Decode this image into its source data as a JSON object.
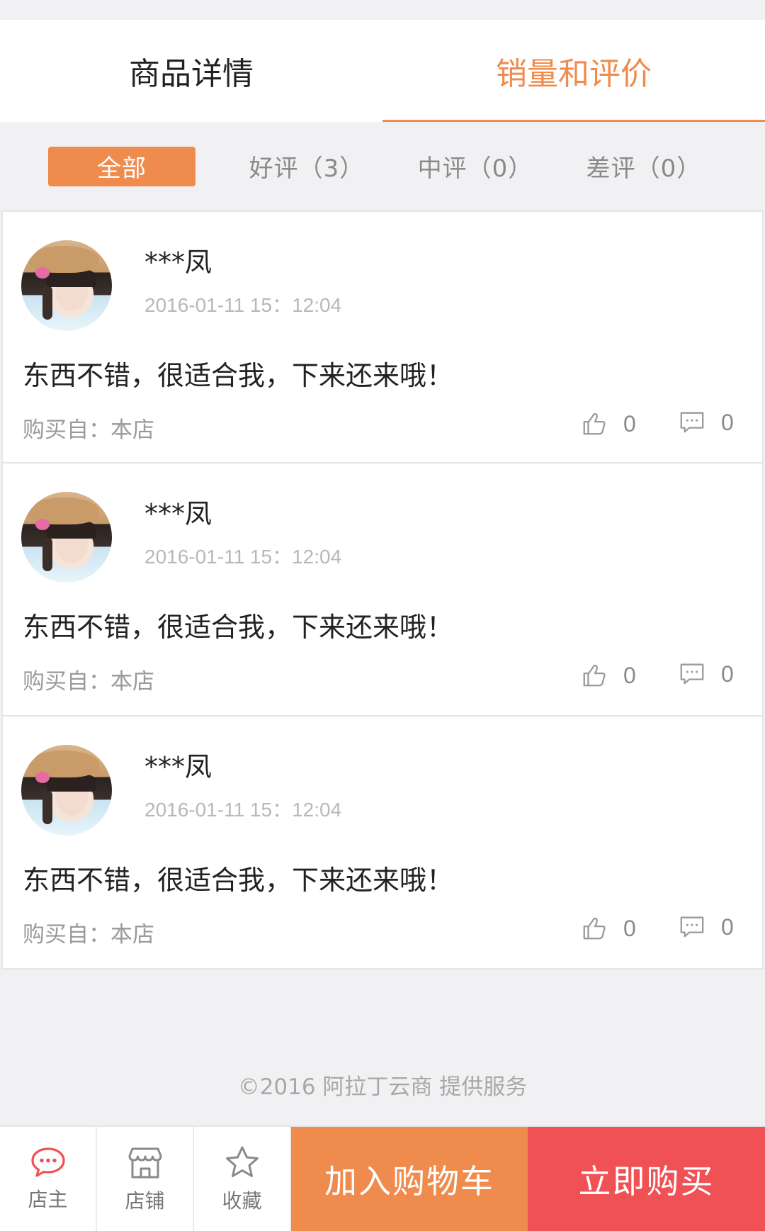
{
  "tabs": [
    {
      "label": "商品详情"
    },
    {
      "label": "销量和评价"
    }
  ],
  "active_tab": 1,
  "filters": [
    {
      "label": "全部"
    },
    {
      "label": "好评（3）"
    },
    {
      "label": "中评（0）"
    },
    {
      "label": "差评（0）"
    }
  ],
  "reviews": [
    {
      "name": "***凤",
      "time": "2016-01-11  15：12:04",
      "content": "东西不错，很适合我，下来还来哦！",
      "source": "购买自：本店",
      "likes": "0",
      "comments": "0"
    },
    {
      "name": "***凤",
      "time": "2016-01-11  15：12:04",
      "content": "东西不错，很适合我，下来还来哦！",
      "source": "购买自：本店",
      "likes": "0",
      "comments": "0"
    },
    {
      "name": "***凤",
      "time": "2016-01-11  15：12:04",
      "content": "东西不错，很适合我，下来还来哦！",
      "source": "购买自：本店",
      "likes": "0",
      "comments": "0"
    }
  ],
  "copyright": "©2016 阿拉丁云商 提供服务",
  "bottom_nav": [
    {
      "label": "店主",
      "icon": "chat-bubble-icon"
    },
    {
      "label": "店铺",
      "icon": "store-icon"
    },
    {
      "label": "收藏",
      "icon": "star-icon"
    }
  ],
  "add_to_cart": "加入购物车",
  "buy_now": "立即购买",
  "colors": {
    "accent": "#ef8b4d",
    "buy": "#ef5155",
    "chat": "#ef5155"
  }
}
